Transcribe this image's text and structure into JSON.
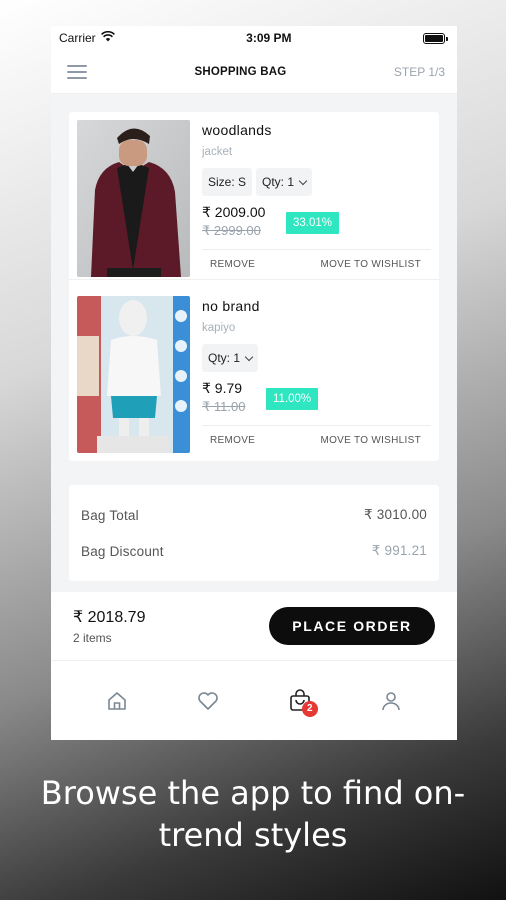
{
  "status": {
    "carrier": "Carrier",
    "time": "3:09 PM"
  },
  "header": {
    "title": "SHOPPING BAG",
    "step": "STEP 1/3",
    "menu_icon": "hamburger-icon"
  },
  "cart_items": [
    {
      "brand": "woodlands",
      "name": "jacket",
      "size_label": "Size: S",
      "qty_label": "Qty: 1",
      "price": "₹ 2009.00",
      "mrp": "₹ 2999.00",
      "discount": "33.01%",
      "remove": "REMOVE",
      "wishlist": "MOVE TO WISHLIST"
    },
    {
      "brand": "no brand",
      "name": "kapiyo",
      "qty_label": "Qty: 1",
      "price": "₹ 9.79",
      "mrp": "₹ 11.00",
      "discount": "11.00%",
      "remove": "REMOVE",
      "wishlist": "MOVE TO WISHLIST"
    }
  ],
  "summary": {
    "bag_total_label": "Bag Total",
    "bag_total_value": "₹ 3010.00",
    "bag_discount_label": "Bag Discount",
    "bag_discount_value": "₹ 991.21"
  },
  "checkout": {
    "grand_total": "₹ 2018.79",
    "items_count": "2 items",
    "button": "PLACE ORDER"
  },
  "tabbar": {
    "icons": [
      "home-icon",
      "heart-icon",
      "bag-icon",
      "user-icon"
    ],
    "bag_badge": "2"
  },
  "caption": "Browse the app to find on-trend styles",
  "colors": {
    "discount_badge": "#2ee6c0",
    "order_button": "#0d0d0d",
    "badge": "#e53935"
  }
}
